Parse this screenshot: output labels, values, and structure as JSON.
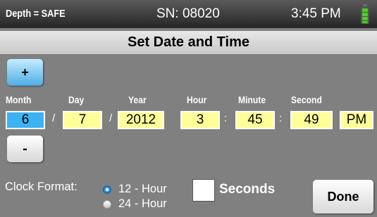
{
  "status_bar": {
    "depth": "Depth = SAFE",
    "serial": "SN: 08020",
    "time": "3:45 PM",
    "battery_icon": "battery-full-icon"
  },
  "title": "Set Date and Time",
  "buttons": {
    "increment": "+",
    "decrement": "-",
    "done": "Done"
  },
  "labels": {
    "month": "Month",
    "day": "Day",
    "year": "Year",
    "hour": "Hour",
    "minute": "Minute",
    "second": "Second"
  },
  "values": {
    "month": "6",
    "day": "7",
    "year": "2012",
    "hour": "3",
    "minute": "45",
    "second": "49",
    "ampm": "PM"
  },
  "separators": {
    "date": "/",
    "time": ":"
  },
  "clock_format": {
    "label": "Clock Format:",
    "options": [
      "12 - Hour",
      "24 - Hour"
    ],
    "selected": "12 - Hour"
  },
  "seconds_checkbox": {
    "label": "Seconds",
    "checked": false
  },
  "colors": {
    "background": "#808080",
    "field": "#ffff99",
    "selected_field": "#3cb2f2",
    "battery": "#48d020"
  }
}
